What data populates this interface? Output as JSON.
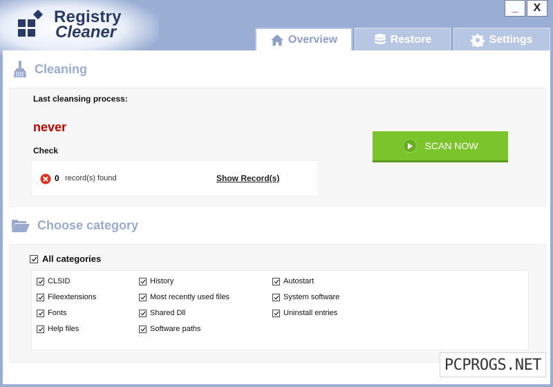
{
  "app": {
    "logo_line1": "Registry",
    "logo_line2": "Cleaner"
  },
  "window": {
    "minimize_label": "_",
    "close_label": "X"
  },
  "tabs": [
    {
      "label": "Overview",
      "icon": "home-icon",
      "active": true
    },
    {
      "label": "Restore",
      "icon": "database-icon",
      "active": false
    },
    {
      "label": "Settings",
      "icon": "gear-icon",
      "active": false
    }
  ],
  "cleaning": {
    "title": "Cleaning",
    "last_label": "Last cleansing process:",
    "last_value": "never",
    "check_label": "Check",
    "record_count": "0",
    "records_text": "record(s) found",
    "show_records": "Show Record(s)",
    "scan_button": "SCAN NOW"
  },
  "category": {
    "title": "Choose category",
    "all_label": "All categories",
    "items": [
      {
        "label": "CLSID",
        "checked": true
      },
      {
        "label": "Fileextensions",
        "checked": true
      },
      {
        "label": "Fonts",
        "checked": true
      },
      {
        "label": "Help files",
        "checked": true
      },
      {
        "label": "History",
        "checked": true
      },
      {
        "label": "Most recently used files",
        "checked": true
      },
      {
        "label": "Shared Dll",
        "checked": true
      },
      {
        "label": "Software paths",
        "checked": true
      },
      {
        "label": "Autostart",
        "checked": true
      },
      {
        "label": "System software",
        "checked": true
      },
      {
        "label": "Uninstall entries",
        "checked": true
      }
    ]
  },
  "watermark": "PCPROGS.NET",
  "colors": {
    "frame": "#9aaed4",
    "accent_text": "#9aabcf",
    "scan_green": "#7cc42b",
    "never_red": "#c00000",
    "error_red": "#e0301e"
  }
}
